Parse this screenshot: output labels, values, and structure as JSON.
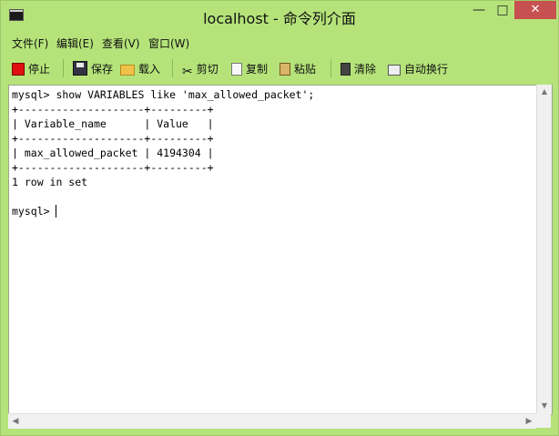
{
  "window": {
    "title": "localhost - 命令列介面",
    "minimize_glyph": "—",
    "maximize_glyph": "□",
    "close_glyph": "✕"
  },
  "menu": {
    "items": [
      "文件(F)",
      "编辑(E)",
      "查看(V)",
      "窗口(W)"
    ]
  },
  "toolbar": {
    "stop": "停止",
    "save": "保存",
    "load": "载入",
    "cut": "剪切",
    "copy": "复制",
    "paste": "粘贴",
    "clear": "清除",
    "wrap": "自动换行"
  },
  "console": {
    "lines": [
      "mysql> show VARIABLES like 'max_allowed_packet';",
      "+--------------------+---------+",
      "| Variable_name      | Value   |",
      "+--------------------+---------+",
      "| max_allowed_packet | 4194304 |",
      "+--------------------+---------+",
      "1 row in set",
      ""
    ],
    "prompt": "mysql> "
  },
  "scrollbar": {
    "up": "▲",
    "down": "▼",
    "left": "◀",
    "right": "▶"
  }
}
